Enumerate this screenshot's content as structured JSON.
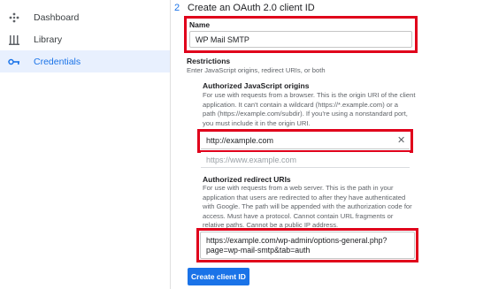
{
  "sidebar": {
    "items": [
      {
        "label": "Dashboard",
        "icon": "dashboard-icon"
      },
      {
        "label": "Library",
        "icon": "library-icon"
      },
      {
        "label": "Credentials",
        "icon": "key-icon",
        "active": true
      }
    ]
  },
  "step": {
    "number": "2",
    "title": "Create an OAuth 2.0 client ID"
  },
  "name_field": {
    "label": "Name",
    "value": "WP Mail SMTP"
  },
  "restrictions": {
    "title": "Restrictions",
    "subtitle": "Enter JavaScript origins, redirect URIs, or both"
  },
  "js_origins": {
    "title": "Authorized JavaScript origins",
    "description_lines": [
      "For use with requests from a browser. This is the origin URI of the client",
      "application. It can't contain a wildcard (https://*.example.com) or a",
      "path (https://example.com/subdir). If you're using a nonstandard port,",
      "you must include it in the origin URI."
    ],
    "value": "http://example.com",
    "placeholder": "https://www.example.com"
  },
  "redirect_uris": {
    "title": "Authorized redirect URIs",
    "description_lines": [
      "For use with requests from a web server. This is the path in your",
      "application that users are redirected to after they have authenticated",
      "with Google. The path will be appended with the authorization code for",
      "access. Must have a protocol. Cannot contain URL fragments or",
      "relative paths. Cannot be a public IP address."
    ],
    "value_lines": [
      "https://example.com/wp-admin/options-general.php?",
      "page=wp-mail-smtp&tab=auth"
    ]
  },
  "create_button": {
    "label": "Create client ID"
  },
  "colors": {
    "accent": "#1a73e8",
    "highlight_box": "#e0001b",
    "active_bg": "#e8f0fe"
  }
}
